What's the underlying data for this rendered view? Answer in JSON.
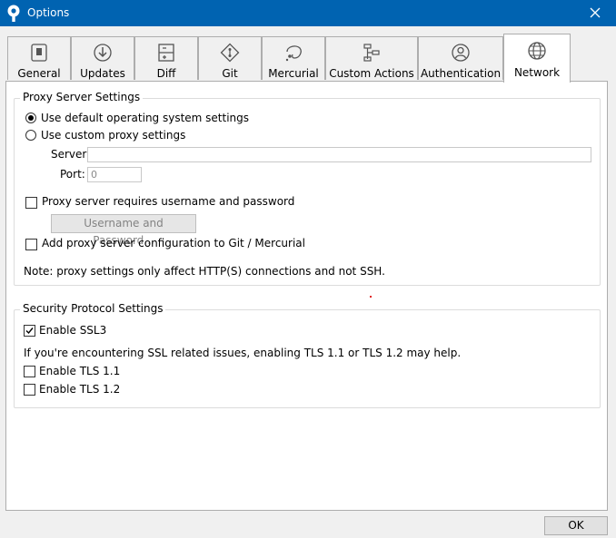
{
  "window": {
    "title": "Options",
    "icon": "sourcetree-icon"
  },
  "tabs": [
    {
      "label": "General",
      "icon": "general-icon"
    },
    {
      "label": "Updates",
      "icon": "updates-icon"
    },
    {
      "label": "Diff",
      "icon": "diff-icon"
    },
    {
      "label": "Git",
      "icon": "git-icon"
    },
    {
      "label": "Mercurial",
      "icon": "mercurial-icon"
    },
    {
      "label": "Custom Actions",
      "icon": "custom-actions-icon"
    },
    {
      "label": "Authentication",
      "icon": "authentication-icon"
    },
    {
      "label": "Network",
      "icon": "network-icon",
      "active": true
    }
  ],
  "proxy": {
    "group_title": "Proxy Server Settings",
    "radio_default": "Use default operating system settings",
    "radio_default_selected": true,
    "radio_custom": "Use custom proxy settings",
    "server_label": "Server:",
    "server_value": "",
    "port_label": "Port:",
    "port_value": "0",
    "requires_auth_label": "Proxy server requires username and password",
    "requires_auth_checked": false,
    "credentials_button": "Username and Password...",
    "add_to_git_label": "Add proxy server configuration to Git / Mercurial",
    "add_to_git_checked": false,
    "note": "Note: proxy settings only affect HTTP(S) connections and not SSH."
  },
  "security": {
    "group_title": "Security Protocol Settings",
    "ssl3_label": "Enable SSL3",
    "ssl3_checked": true,
    "info": "If you're encountering SSL related issues, enabling TLS 1.1 or TLS 1.2 may help.",
    "tls11_label": "Enable TLS 1.1",
    "tls11_checked": false,
    "tls12_label": "Enable TLS 1.2",
    "tls12_checked": false
  },
  "ok_button": "OK",
  "colors": {
    "titlebar": "#0063b1",
    "panel": "#ffffff",
    "dialog_bg": "#f0f0f0"
  }
}
